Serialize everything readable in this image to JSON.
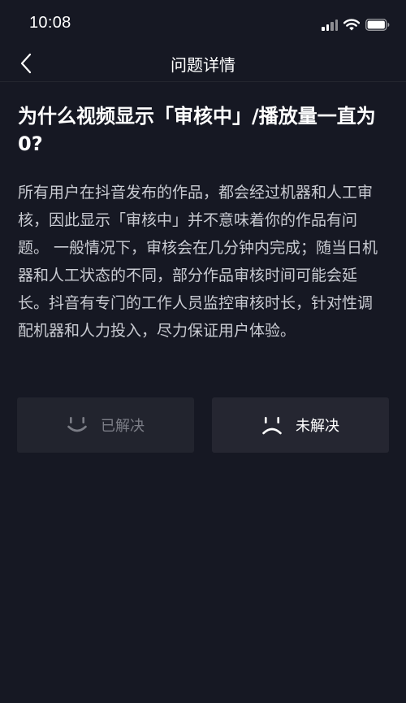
{
  "status_bar": {
    "time": "10:08",
    "icons": [
      "signal-icon",
      "wifi-icon",
      "battery-icon"
    ]
  },
  "nav": {
    "back_icon": "chevron-left-icon",
    "title": "问题详情"
  },
  "question": {
    "title": "为什么视频显示「审核中」/播放量一直为0?",
    "answer": "所有用户在抖音发布的作品，都会经过机器和人工审核，因此显示「审核中」并不意味着你的作品有问题。 一般情况下，审核会在几分钟内完成；随当日机器和人工状态的不同，部分作品审核时间可能会延长。抖音有专门的工作人员监控审核时长，针对性调配机器和人力投入，尽力保证用户体验。"
  },
  "feedback": {
    "resolved": {
      "label": "已解决",
      "icon": "smile-icon"
    },
    "unresolved": {
      "label": "未解决",
      "icon": "frown-icon"
    }
  },
  "colors": {
    "background": "#161823",
    "button_background": "#252631",
    "body_text": "#c9cbd2",
    "muted_text": "#7b7d86"
  }
}
